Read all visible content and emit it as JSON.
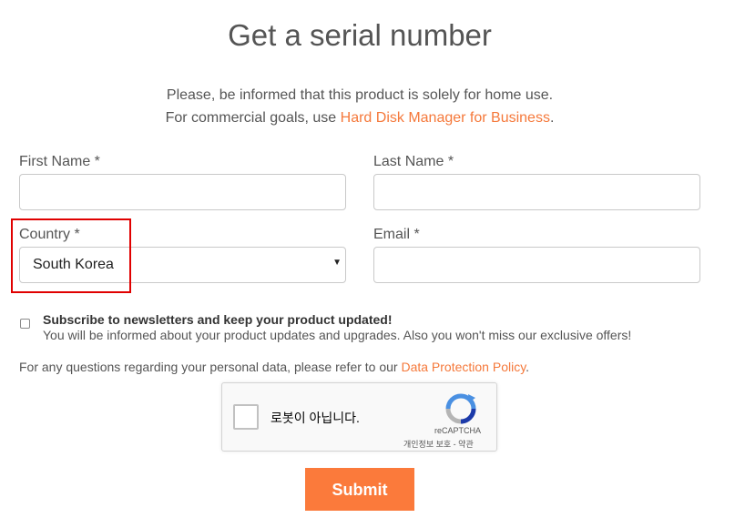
{
  "page": {
    "title": "Get a serial number",
    "intro_line1": "Please, be informed that this product is solely for home use.",
    "intro_line2_prefix": "For commercial goals, use ",
    "intro_link": "Hard Disk Manager for Business",
    "intro_line2_suffix": "."
  },
  "form": {
    "first_name_label": "First Name *",
    "first_name_value": "",
    "last_name_label": "Last Name *",
    "last_name_value": "",
    "country_label": "Country *",
    "country_value": "South Korea",
    "email_label": "Email *",
    "email_value": "",
    "subscribe_title": "Subscribe to newsletters and keep your product updated!",
    "subscribe_desc": "You will be informed about your product updates and upgrades. Also you won't miss our exclusive offers!",
    "privacy_prefix": "For any questions regarding your personal data, please refer to our ",
    "privacy_link": "Data Protection Policy",
    "privacy_suffix": ".",
    "submit_label": "Submit"
  },
  "captcha": {
    "label": "로봇이 아닙니다.",
    "brand": "reCAPTCHA",
    "links": "개인정보 보호 - 약관",
    "logo_icon": "recaptcha-logo-icon"
  },
  "colors": {
    "accent": "#fb7a3b",
    "link": "#f5793b",
    "highlight": "#e00000"
  }
}
